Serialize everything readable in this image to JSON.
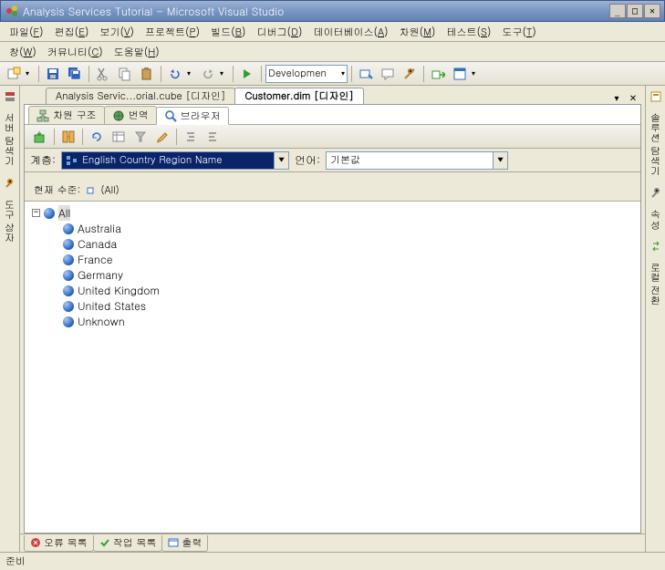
{
  "window": {
    "title": "Analysis Services Tutorial - Microsoft Visual Studio"
  },
  "menu": {
    "file": "파일",
    "file_m": "F",
    "edit": "편집",
    "edit_m": "E",
    "view": "보기",
    "view_m": "V",
    "project": "프로젝트",
    "project_m": "P",
    "build": "빌드",
    "build_m": "B",
    "debug": "디버그",
    "debug_m": "D",
    "database": "데이터베이스",
    "database_m": "A",
    "dimension": "차원",
    "dimension_m": "M",
    "test": "테스트",
    "test_m": "S",
    "tools": "도구",
    "tools_m": "T",
    "window": "창",
    "window_m": "W",
    "community": "커뮤니티",
    "community_m": "C",
    "help": "도움말",
    "help_m": "H"
  },
  "toolbar": {
    "config": "Developmen"
  },
  "side_left": {
    "tab1": "서버 탐색기",
    "tab2": "도구 상자"
  },
  "side_right": {
    "tab1": "솔루션 탐색기",
    "tab2": "속성",
    "tab3": "로컬 전환"
  },
  "doc_tabs": {
    "tab1": "Analysis Servic...orial.cube [디자인]",
    "tab2": "Customer.dim [디자인]"
  },
  "inner_tabs": {
    "structure": "차원 구조",
    "translate": "번역",
    "browser": "브라우저"
  },
  "hierarchy": {
    "label": "계층:",
    "value": "English Country Region Name",
    "lang_label": "언어:",
    "lang_value": "기본값"
  },
  "level": {
    "label": "현재 수준:",
    "value": "(All)"
  },
  "tree": {
    "root": "All",
    "items": [
      "Australia",
      "Canada",
      "France",
      "Germany",
      "United Kingdom",
      "United States",
      "Unknown"
    ]
  },
  "bottom_tabs": {
    "errors": "오류 목록",
    "tasks": "작업 목록",
    "output": "출력"
  },
  "status": {
    "text": "준비"
  }
}
